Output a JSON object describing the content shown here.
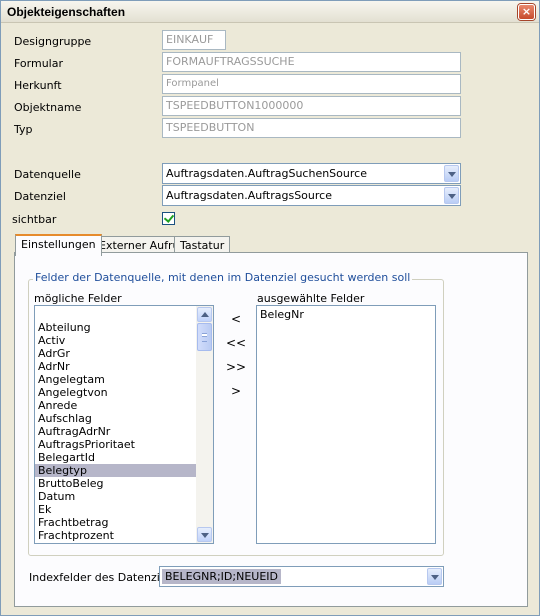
{
  "window": {
    "title": "Objekteigenschaften",
    "close_glyph": "×"
  },
  "properties": {
    "designgruppe": {
      "label": "Designgruppe",
      "value": "EINKAUF"
    },
    "formular": {
      "label": "Formular",
      "value": "FORMAUFTRAGSSUCHE"
    },
    "herkunft": {
      "label": "Herkunft",
      "value": "Formpanel"
    },
    "objektname": {
      "label": "Objektname",
      "value": "TSPEEDBUTTON1000000"
    },
    "typ": {
      "label": "Typ",
      "value": "TSPEEDBUTTON"
    }
  },
  "datasource": {
    "datenquelle": {
      "label": "Datenquelle",
      "value": "Auftragsdaten.AuftragSuchenSource"
    },
    "datenziel": {
      "label": "Datenziel",
      "value": "Auftragsdaten.AuftragsSource"
    },
    "sichtbar": {
      "label": "sichtbar",
      "checked": true
    }
  },
  "tabs": [
    {
      "label": "Einstellungen",
      "active": true
    },
    {
      "label": "Externer Aufruf",
      "active": false
    },
    {
      "label": "Tastatur",
      "active": false
    }
  ],
  "group": {
    "title": "Felder der Datenquelle, mit denen im Datenziel gesucht werden soll",
    "available_caption": "mögliche Felder",
    "selected_caption": "ausgewählte Felder",
    "available_fields": [
      "Abteilung",
      "Activ",
      "AdrGr",
      "AdrNr",
      "Angelegtam",
      "Angelegtvon",
      "Anrede",
      "Aufschlag",
      "AuftragAdrNr",
      "AuftragsPrioritaet",
      "BelegartId",
      "Belegtyp",
      "BruttoBeleg",
      "Datum",
      "Ek",
      "Frachtbetrag",
      "Frachtprozent"
    ],
    "selected_available": "Belegtyp",
    "selected_fields": [
      "BelegNr"
    ],
    "buttons": {
      "add": "<",
      "add_all": "<<",
      "remove_all": ">>",
      "remove": ">"
    }
  },
  "index_fields": {
    "label": "Indexfelder des Datenziels",
    "value": "BELEGNR;ID;NEUEID"
  }
}
